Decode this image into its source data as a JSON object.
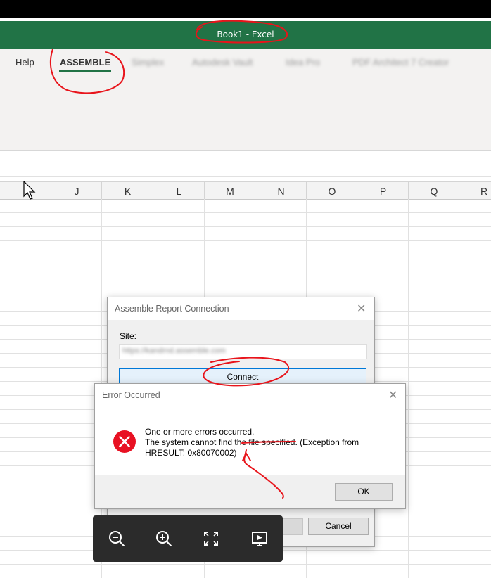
{
  "window": {
    "title": "Book1  -  Excel"
  },
  "ribbon": {
    "tabs": [
      {
        "label": "Help"
      },
      {
        "label": "ASSEMBLE"
      },
      {
        "label": "Simplex"
      },
      {
        "label": "Autodesk Vault"
      },
      {
        "label": "Idea Pro"
      },
      {
        "label": "PDF Architect 7 Creator"
      }
    ]
  },
  "columns": [
    "J",
    "K",
    "L",
    "M",
    "N",
    "O",
    "P",
    "Q",
    "R"
  ],
  "connection_dialog": {
    "title": "Assemble Report Connection",
    "site_label": "Site:",
    "site_value": "https://kandrnd.assemble.com",
    "connect_label": "Connect",
    "cancel_label": "Cancel"
  },
  "error_dialog": {
    "title": "Error Occurred",
    "line1": "One or more errors occurred.",
    "line2": "The system cannot find the file specified. (Exception from",
    "line3": "HRESULT: 0x80070002)",
    "ok_label": "OK"
  },
  "viewer_toolbar": {
    "icons": [
      "zoom-out-icon",
      "zoom-in-icon",
      "fit-screen-icon",
      "slideshow-icon"
    ]
  },
  "colors": {
    "excel_green": "#217346",
    "annotation_red": "#e8141b",
    "error_red": "#e81123"
  }
}
